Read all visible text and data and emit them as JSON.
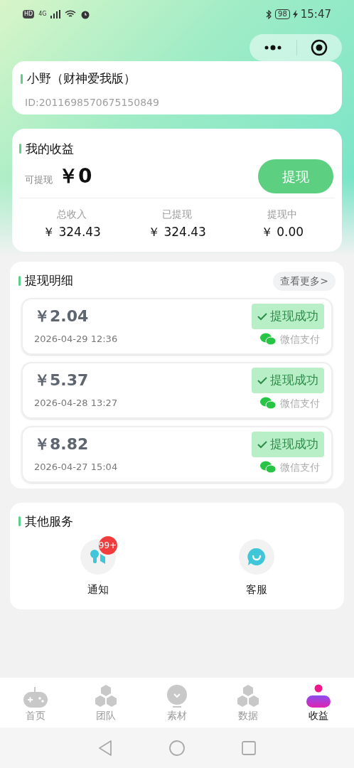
{
  "status_bar": {
    "hd": "HD",
    "network": "4G",
    "battery": "98",
    "time": "15:47"
  },
  "profile": {
    "name": "小野（财神爱我版）",
    "id": "ID:2011698570675150849"
  },
  "earnings": {
    "title": "我的收益",
    "available_label": "可提现",
    "available": "￥0",
    "withdraw_button": "提现",
    "stats": [
      {
        "label": "总收入",
        "value": "￥ 324.43"
      },
      {
        "label": "已提现",
        "value": "￥ 324.43"
      },
      {
        "label": "提现中",
        "value": "￥ 0.00"
      }
    ]
  },
  "withdrawals": {
    "title": "提现明细",
    "more": "查看更多>",
    "records": [
      {
        "amount": "￥2.04",
        "time": "2026-04-29 12:36",
        "status": "提现成功",
        "method": "微信支付"
      },
      {
        "amount": "￥5.37",
        "time": "2026-04-28 13:27",
        "status": "提现成功",
        "method": "微信支付"
      },
      {
        "amount": "￥8.82",
        "time": "2026-04-27 15:04",
        "status": "提现成功",
        "method": "微信支付"
      }
    ]
  },
  "services": {
    "title": "其他服务",
    "items": [
      {
        "kind": "notice",
        "label": "通知",
        "badge": "99+"
      },
      {
        "kind": "support",
        "label": "客服"
      }
    ]
  },
  "tabs": [
    {
      "kind": "gamepad",
      "label": "首页",
      "selected": false
    },
    {
      "kind": "hexes",
      "label": "团队",
      "selected": false
    },
    {
      "kind": "bulb",
      "label": "素材",
      "selected": false
    },
    {
      "kind": "hexes",
      "label": "数据",
      "selected": false
    },
    {
      "kind": "person",
      "label": "收益",
      "selected": true
    }
  ]
}
